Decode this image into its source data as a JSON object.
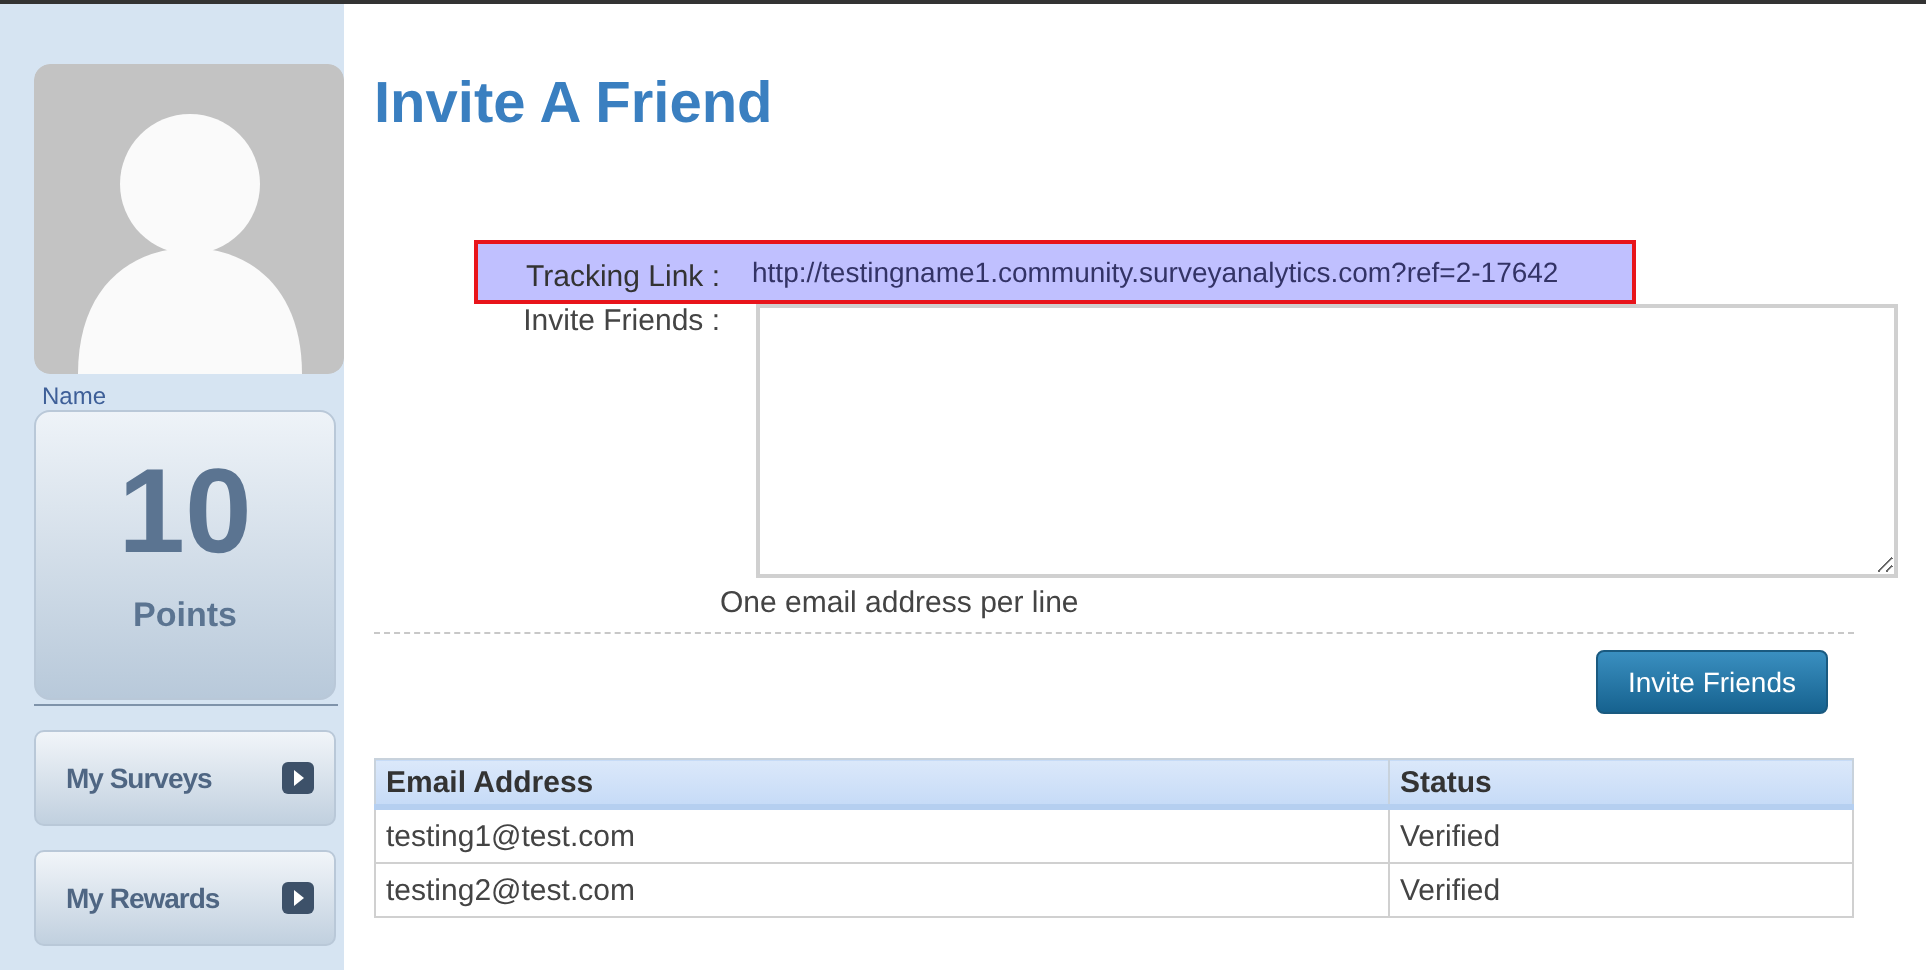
{
  "sidebar": {
    "name": "Name",
    "points": {
      "value": "10",
      "label": "Points"
    },
    "items": [
      {
        "label": "My Surveys"
      },
      {
        "label": "My Rewards"
      }
    ]
  },
  "page": {
    "title": "Invite A Friend"
  },
  "form": {
    "tracking_label": "Tracking Link :",
    "tracking_link": "http://testingname1.community.surveyanalytics.com?ref=2-17642",
    "invite_label": "Invite Friends :",
    "hint": "One email address per line",
    "button": "Invite Friends"
  },
  "table": {
    "columns": [
      "Email Address",
      "Status"
    ],
    "rows": [
      [
        "testing1@test.com",
        "Verified"
      ],
      [
        "testing2@test.com",
        "Verified"
      ]
    ]
  }
}
